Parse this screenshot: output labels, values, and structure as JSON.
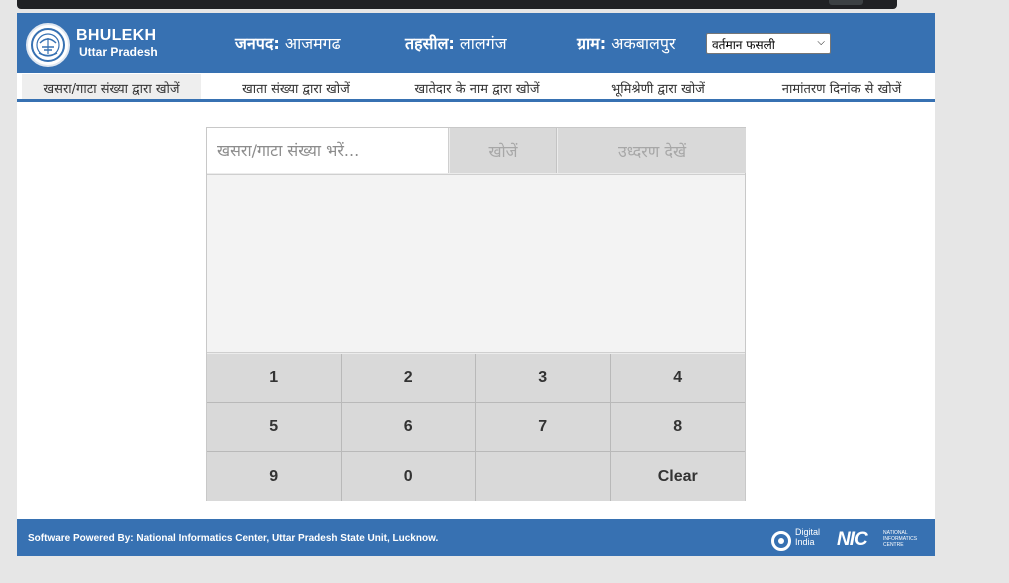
{
  "header": {
    "brand_title": "BHULEKH",
    "brand_subtitle": "Uttar Pradesh",
    "janpad_label": "जनपद:",
    "janpad_value": "आजमगढ",
    "tehsil_label": "तहसील:",
    "tehsil_value": "लालगंज",
    "gram_label": "ग्राम:",
    "gram_value": "अकबालपुर",
    "fasli_selected": "वर्तमान फसली"
  },
  "nav": {
    "tabs": [
      "खसरा/गाटा संख्या द्वारा खोजें",
      "खाता संख्या द्वारा खोजें",
      "खातेदार के नाम द्वारा खोजें",
      "भूमिश्रेणी द्वारा खोजें",
      "नामांतरण दिनांक से खोजें"
    ],
    "active_index": 0
  },
  "search": {
    "placeholder": "खसरा/गाटा संख्या भरें...",
    "search_button": "खोजें",
    "extract_button": "उध्दरण देखें"
  },
  "keypad": {
    "keys": [
      "1",
      "2",
      "3",
      "4",
      "5",
      "6",
      "7",
      "8",
      "9",
      "0",
      "",
      "Clear"
    ]
  },
  "footer": {
    "powered_by": "Software Powered By: National Informatics Center, Uttar Pradesh State Unit, Lucknow.",
    "digital_india": "Digital\nIndia",
    "nic_mark": "NIC",
    "nic_words": "NATIONAL\nINFORMATICS\nCENTRE"
  },
  "colors": {
    "brand_blue": "#3771b2",
    "keypad_gray": "#d9d9d9"
  },
  "icons": [
    "up-emblem-icon",
    "chevron-down-icon",
    "digital-india-icon",
    "nic-logo-icon"
  ]
}
